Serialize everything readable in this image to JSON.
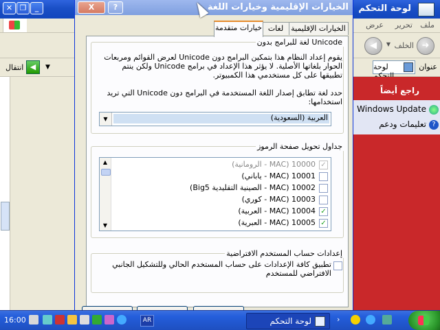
{
  "background_window": {
    "title": "لوحة التحكم",
    "menu": [
      "ملف",
      "تحرير",
      "عرض"
    ],
    "back_label": "الخلف",
    "address_label": "عنوان",
    "address_value": "لوحة التحكم",
    "go_label": "انتقال",
    "see_also": {
      "header": "راجع أيضاً",
      "items": [
        "Windows Update",
        "تعليمات ودعم"
      ]
    }
  },
  "dialog": {
    "title": "الخيارات الإقليمية وخيارات اللغة",
    "close_label": "X",
    "help_label": "?",
    "tabs": [
      "الخيارات الإقليمية",
      "لغات",
      "خيارات متقدمة"
    ],
    "active_tab": 2,
    "non_unicode": {
      "group_title": "لغة للبرامج بدون Unicode",
      "description": "يقوم إعداد النظام هذا بتمكين البرامج دون Unicode لعرض القوائم ومربعات الحوار بلغاتها الأصلية. لا يؤثر هذا الإعداد في برامج Unicode ولكن ينتم تطبيقها على كل مستخدمي هذا الكمبيوتر.",
      "prompt": "حدد لغة تطابق إصدار اللغة المستخدمة في البرامج دون Unicode التي تريد استخدامها:",
      "selected_language": "العربية (السعودية)"
    },
    "code_pages": {
      "group_title": "جداول تحويل صفحة الرموز",
      "items": [
        {
          "label": "10000 (MAC - الرومانية)",
          "checked": true,
          "dim": true
        },
        {
          "label": "10001 (MAC - ياباني)",
          "checked": false,
          "dim": false
        },
        {
          "label": "10002 (MAC - الصينية التقليدية Big5)",
          "checked": false,
          "dim": false
        },
        {
          "label": "10003 (MAC - كوري)",
          "checked": false,
          "dim": false
        },
        {
          "label": "10004 (MAC - العربية)",
          "checked": true,
          "dim": false
        },
        {
          "label": "10005 (MAC - العبرية)",
          "checked": true,
          "dim": false
        }
      ]
    },
    "default_user": {
      "group_title": "إعدادات حساب المستخدم الافتراضية",
      "checkbox_label": "تطبيق كافة الإعدادات على حساب المستخدم الحالي وللتشكيل الجانبي الافتراضي للمستخدم",
      "checked": false
    }
  },
  "taskbar": {
    "clock": "16:00",
    "language": "AR",
    "task_label": "لوحة التحكم"
  },
  "colors": {
    "taskbar": "#245edb",
    "see_also_red": "#c9282a",
    "active_tab_accent": "#e68b2c"
  }
}
